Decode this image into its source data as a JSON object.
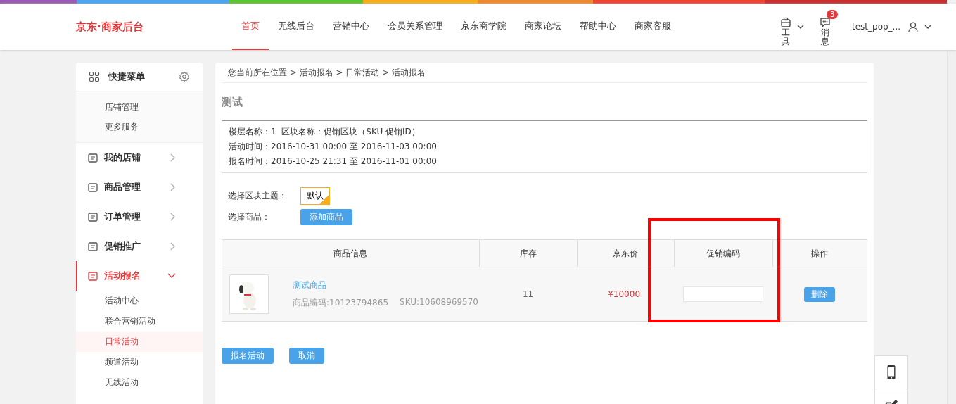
{
  "header": {
    "logo": "京东·商家后台",
    "nav": [
      {
        "label": "首页",
        "selected": true
      },
      {
        "label": "无线后台",
        "selected": false
      },
      {
        "label": "营销中心",
        "selected": false
      },
      {
        "label": "会员关系管理",
        "selected": false
      },
      {
        "label": "京东商学院",
        "selected": false
      },
      {
        "label": "商家论坛",
        "selected": false
      },
      {
        "label": "帮助中心",
        "selected": false
      },
      {
        "label": "商家客服",
        "selected": false
      }
    ],
    "tools": "工具",
    "messages": "消息",
    "message_count": "3",
    "user": "test_pop_..."
  },
  "sidebar": {
    "quick_menu": {
      "title": "快捷菜单",
      "links": [
        "店铺管理",
        "更多服务"
      ]
    },
    "items": [
      {
        "label": "我的店铺",
        "expanded": false
      },
      {
        "label": "商品管理",
        "expanded": false
      },
      {
        "label": "订单管理",
        "expanded": false
      },
      {
        "label": "促销推广",
        "expanded": false
      },
      {
        "label": "活动报名",
        "expanded": true,
        "children": [
          {
            "label": "活动中心",
            "selected": false
          },
          {
            "label": "联合营销活动",
            "selected": false
          },
          {
            "label": "日常活动",
            "selected": true
          },
          {
            "label": "频道活动",
            "selected": false
          },
          {
            "label": "无线活动",
            "selected": false
          }
        ]
      }
    ]
  },
  "breadcrumb": "您当前所在位置 > 活动报名 > 日常活动 > 活动报名",
  "title": "测试",
  "info": [
    "楼层名称：1  区块名称：促销区块（SKU 促销ID）",
    "活动时间：2016-10-31 00:00 至 2016-11-03 00:00",
    "报名时间：2016-10-25 21:31 至 2016-11-01 00:00"
  ],
  "theme": {
    "label": "选择区块主题：",
    "options": [
      {
        "label": "默认",
        "selected": true
      }
    ]
  },
  "product_select": {
    "label": "选择商品：",
    "button": "添加商品"
  },
  "table": {
    "columns": [
      "商品信息",
      "库存",
      "京东价",
      "促销编码",
      "操作"
    ],
    "rows": [
      {
        "name": "测试商品",
        "code": "商品编码:10123794865",
        "sku": "SKU:10608969570",
        "stock": "11",
        "price": "¥10000",
        "promo_code": "",
        "action": "删除"
      }
    ]
  },
  "buttons": [
    "报名活动",
    "取消"
  ]
}
